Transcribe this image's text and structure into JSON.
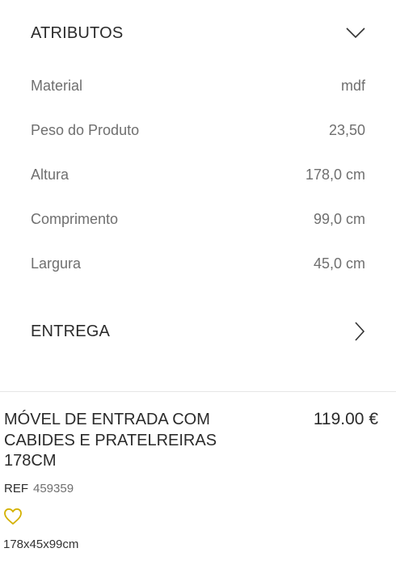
{
  "attributes": {
    "title": "ATRIBUTOS",
    "toggle_icon": "chevron-down-icon",
    "rows": [
      {
        "label": "Material",
        "value": "mdf"
      },
      {
        "label": "Peso do Produto",
        "value": "23,50"
      },
      {
        "label": "Altura",
        "value": "178,0 cm"
      },
      {
        "label": "Comprimento",
        "value": "99,0 cm"
      },
      {
        "label": "Largura",
        "value": "45,0 cm"
      }
    ]
  },
  "delivery": {
    "title": "ENTREGA",
    "toggle_icon": "chevron-right-icon"
  },
  "product": {
    "name": "MÓVEL DE ENTRADA COM CABIDES E PRATELREIRAS 178CM",
    "price": "119.00 €",
    "ref_label": "REF",
    "ref_value": "459359",
    "favorite_icon": "heart-outline-icon",
    "favorite_color": "#d4b100",
    "dimensions": "178x45x99cm"
  }
}
